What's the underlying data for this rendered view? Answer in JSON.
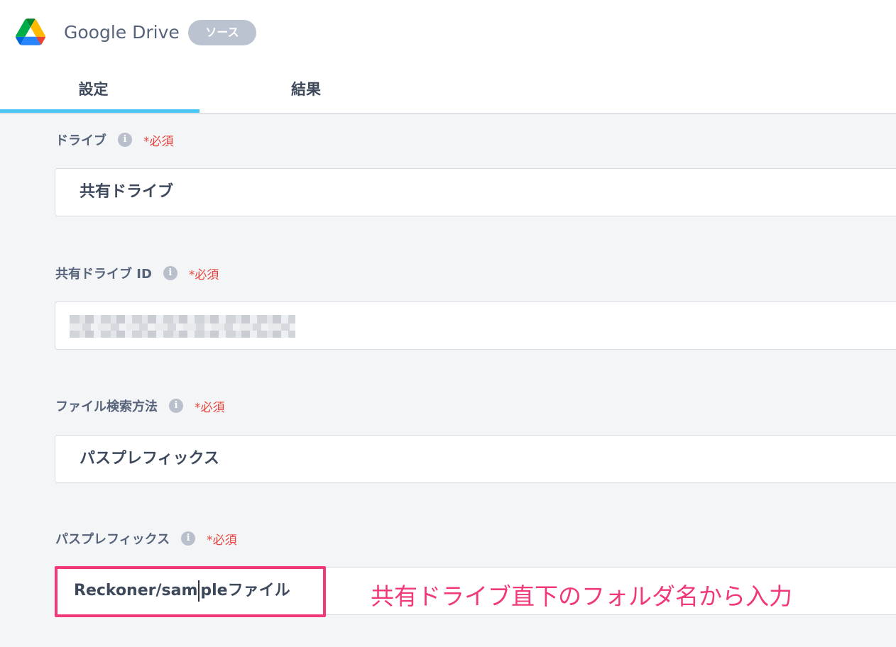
{
  "header": {
    "app_title": "Google Drive",
    "badge": "ソース",
    "logo_icon": "google-drive-logo"
  },
  "tabs": [
    {
      "label": "設定",
      "active": true
    },
    {
      "label": "結果",
      "active": false
    }
  ],
  "colors": {
    "accent": "#4cc6f4",
    "required": "#e7463f",
    "annotation": "#f0387a"
  },
  "form": {
    "drive": {
      "label": "ドライブ",
      "required": "*必須",
      "value": "共有ドライブ"
    },
    "shared_drive_id": {
      "label": "共有ドライブ ID",
      "required": "*必須",
      "value": ""
    },
    "search_method": {
      "label": "ファイル検索方法",
      "required": "*必須",
      "value": "パスプレフィックス"
    },
    "path_prefix": {
      "label": "パスプレフィックス",
      "required": "*必須",
      "value_before_caret": "Reckoner/sam",
      "value_after_caret": "pleファイル"
    }
  },
  "annotation": {
    "text": "共有ドライブ直下のフォルダ名から入力"
  }
}
